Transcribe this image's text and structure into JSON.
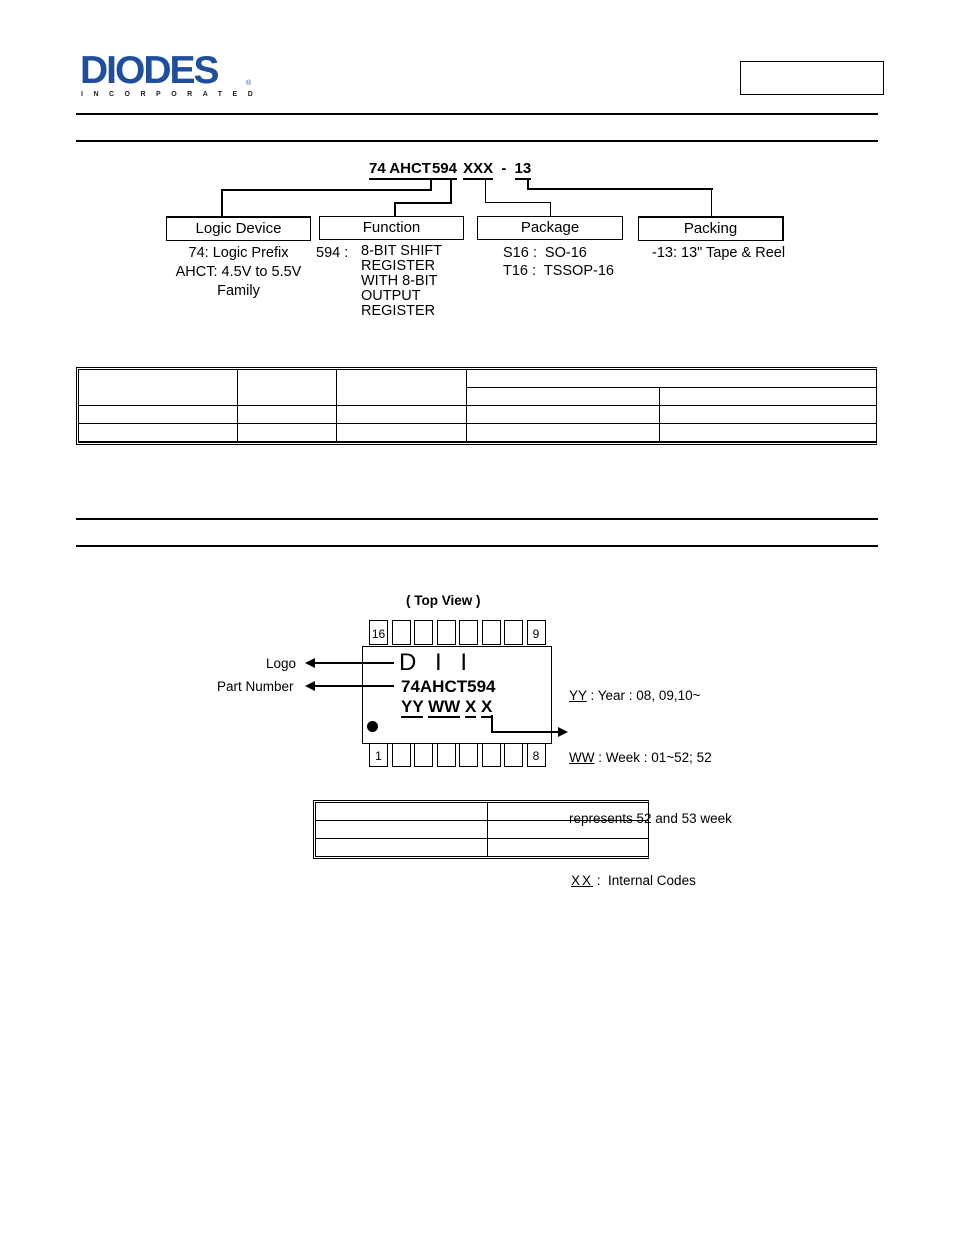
{
  "header": {
    "logo_text": "DIODES",
    "logo_subtext": "INCORPORATED",
    "logo_registered": "®",
    "brand_color": "#1f4e9c",
    "part_number_box": ""
  },
  "ordering": {
    "part_number_segments": [
      "74 AHCT",
      "594",
      "XXX",
      "-",
      "13"
    ],
    "boxes": [
      {
        "label": "Logic Device",
        "description": "74: Logic Prefix\nAHCT: 4.5V to 5.5V\nFamily"
      },
      {
        "label": "Function",
        "code": "594 :",
        "description": "8-BIT SHIFT\nREGISTER\nWITH 8-BIT\nOUTPUT\nREGISTER"
      },
      {
        "label": "Package",
        "description": "S16 :  SO-16\nT16 :  TSSOP-16"
      },
      {
        "label": "Packing",
        "description": "-13: 13\" Tape & Reel"
      }
    ]
  },
  "ordering_table": {
    "rows": [
      [
        "",
        "",
        "",
        "",
        ""
      ],
      [
        "",
        "",
        "",
        "",
        ""
      ]
    ]
  },
  "marking": {
    "top_view_label": "( Top View )",
    "pin_labels": {
      "top_left": "16",
      "top_right": "9",
      "bottom_left": "1",
      "bottom_right": "8"
    },
    "logo_label": "Logo",
    "part_number_label": "Part Number",
    "chip_logo": "D I I",
    "chip_part_number": "74AHCT594",
    "chip_code": [
      "YY",
      "WW",
      "X",
      "X"
    ],
    "notes": [
      {
        "key": "YY",
        "text": " : Year : 08, 09,10~"
      },
      {
        "key": "WW",
        "text": " : Week : 01~52; 52"
      },
      {
        "key": "",
        "text": "represents 52 and 53 week"
      },
      {
        "key": "XX",
        "text": " :  Internal Codes"
      }
    ]
  },
  "marking_table": {
    "rows": [
      [
        "",
        ""
      ],
      [
        "",
        ""
      ],
      [
        "",
        ""
      ]
    ]
  }
}
